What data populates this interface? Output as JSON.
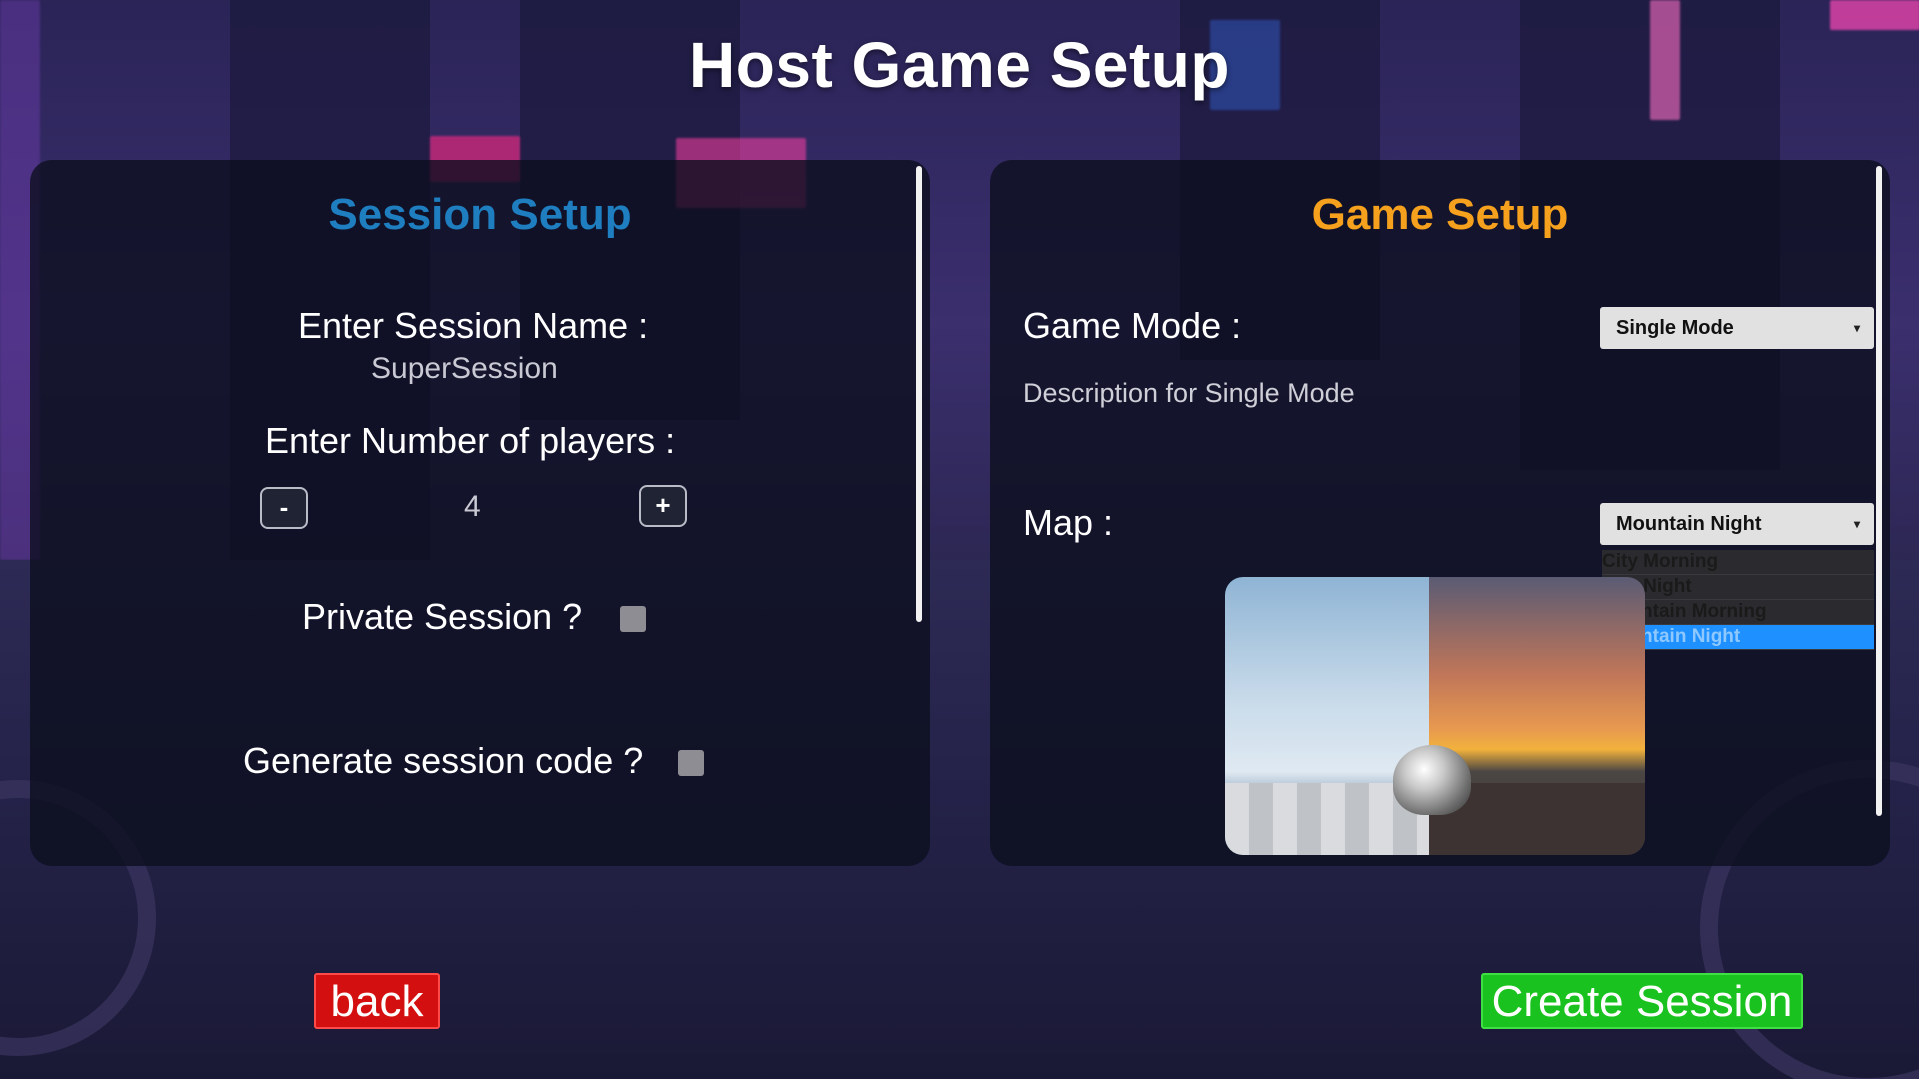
{
  "page": {
    "title": "Host Game Setup"
  },
  "session_setup": {
    "heading": "Session Setup",
    "session_name_label": "Enter Session Name :",
    "session_name_value": "SuperSession",
    "players_label": "Enter Number of players :",
    "players_minus": "-",
    "players_plus": "+",
    "players_value": "4",
    "private_label": "Private Session ?",
    "private_checked": false,
    "code_label": "Generate session code ?",
    "code_checked": false
  },
  "game_setup": {
    "heading": "Game Setup",
    "mode_label": "Game Mode :",
    "mode_selected": "Single Mode",
    "mode_description": "Description for Single Mode",
    "map_label": "Map :",
    "map_selected": "Mountain Night",
    "map_options": [
      "City Morning",
      "City Night",
      "Mountain Morning",
      "Mountain Night"
    ]
  },
  "buttons": {
    "back": "back",
    "create": "Create Session"
  },
  "colors": {
    "session_heading": "#1e7ec0",
    "game_heading": "#f5a11d",
    "back_button": "#d40f0f",
    "create_button": "#19c21e",
    "selected_option": "#1e90ff"
  }
}
